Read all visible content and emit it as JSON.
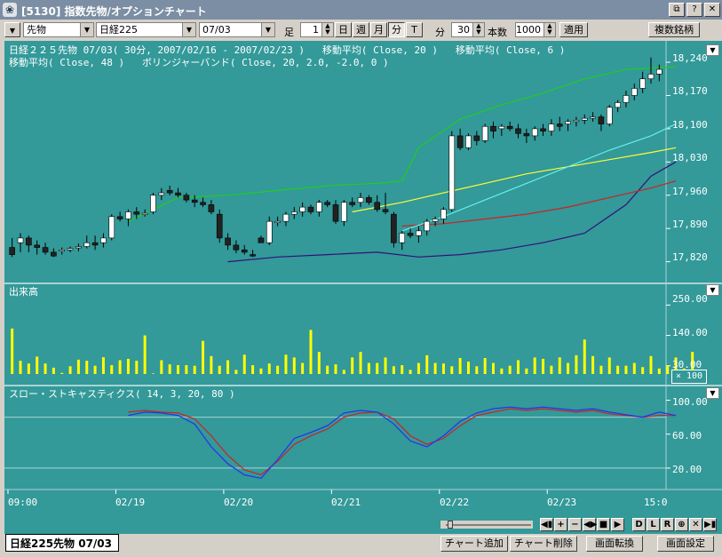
{
  "window": {
    "title": "[5130] 指数先物/オプションチャート",
    "buttons": [
      "⧉",
      "?",
      "✕"
    ]
  },
  "toolbar": {
    "market_select": "先物",
    "index_select": "日経225",
    "month_select": "07/03",
    "ashi_label": "足",
    "ashi_value": "1",
    "period_buttons": [
      "日",
      "週",
      "月",
      "分",
      "T"
    ],
    "pressed_period": "分",
    "minute_label": "分",
    "minute_value": "30",
    "count_label": "本数",
    "count_value": "1000",
    "apply_label": "適用",
    "multi_label": "複数銘柄"
  },
  "price_panel": {
    "header_line1": "日経２２５先物 07/03( 30分, 2007/02/16 - 2007/02/23 )   移動平均( Close, 20 )   移動平均( Close, 6 )",
    "header_line2": "移動平均( Close, 48 )   ボリンジャーバンド( Close, 20, 2.0, -2.0, 0 )",
    "yticks": [
      "18,240",
      "18,170",
      "18,100",
      "18,030",
      "17,960",
      "17,890",
      "17,820"
    ]
  },
  "volume_panel": {
    "title": "出来高",
    "yticks": [
      "250.00",
      "140.00",
      "30.00"
    ],
    "scale": "× 100"
  },
  "stoch_panel": {
    "title": "スロー・ストキャスティクス( 14, 3, 20, 80 )",
    "yticks": [
      "100.00",
      "60.00",
      "20.00"
    ]
  },
  "xaxis": {
    "labels": [
      "09:00",
      "02/19",
      "02/20",
      "02/21",
      "02/22",
      "02/23",
      "15:0"
    ]
  },
  "nav_buttons": [
    "◀▮",
    "+",
    "−",
    "◀▶",
    "■",
    "▶",
    "D",
    "L",
    "R",
    "⊕",
    "✕",
    "▶▮"
  ],
  "bottom": {
    "tab_label": "日経225先物 07/03",
    "buttons": [
      "チャート追加",
      "チャート削除",
      "画面転換",
      "画面設定"
    ]
  },
  "colors": {
    "background": "#339999",
    "ma20": "#cc2222",
    "ma6": "#66eeee",
    "ma48": "#ffff33",
    "bollinger_upper": "#22cc22",
    "bollinger_lower": "#331177",
    "volume": "#ffff00",
    "stoch_k": "#2233ee",
    "stoch_d": "#cc2222"
  },
  "chart_data": [
    {
      "type": "candlestick",
      "title": "日経２２５先物 07/03",
      "ylim": [
        17780,
        18270
      ],
      "y_ticks": [
        18240,
        18170,
        18100,
        18030,
        17960,
        17890,
        17820
      ],
      "candles": [
        [
          17850,
          17870,
          17830,
          17835
        ],
        [
          17860,
          17880,
          17840,
          17870
        ],
        [
          17870,
          17875,
          17840,
          17855
        ],
        [
          17855,
          17865,
          17835,
          17850
        ],
        [
          17850,
          17860,
          17835,
          17840
        ],
        [
          17840,
          17848,
          17830,
          17832
        ],
        [
          17845,
          17850,
          17835,
          17845
        ],
        [
          17845,
          17852,
          17840,
          17848
        ],
        [
          17850,
          17858,
          17842,
          17852
        ],
        [
          17852,
          17875,
          17848,
          17860
        ],
        [
          17860,
          17875,
          17845,
          17855
        ],
        [
          17860,
          17880,
          17850,
          17870
        ],
        [
          17870,
          17920,
          17865,
          17915
        ],
        [
          17915,
          17925,
          17905,
          17910
        ],
        [
          17910,
          17930,
          17895,
          17925
        ],
        [
          17925,
          17935,
          17910,
          17920
        ],
        [
          17920,
          17930,
          17915,
          17922
        ],
        [
          17925,
          17965,
          17920,
          17960
        ],
        [
          17960,
          17975,
          17950,
          17965
        ],
        [
          17970,
          17980,
          17960,
          17965
        ],
        [
          17965,
          17975,
          17955,
          17960
        ],
        [
          17960,
          17965,
          17945,
          17950
        ],
        [
          17950,
          17960,
          17935,
          17945
        ],
        [
          17945,
          17955,
          17935,
          17940
        ],
        [
          17940,
          17950,
          17920,
          17925
        ],
        [
          17920,
          17930,
          17860,
          17870
        ],
        [
          17870,
          17880,
          17845,
          17855
        ],
        [
          17855,
          17865,
          17838,
          17845
        ],
        [
          17845,
          17855,
          17835,
          17840
        ],
        [
          17835,
          17845,
          17830,
          17832
        ],
        [
          17870,
          17875,
          17860,
          17860
        ],
        [
          17860,
          17915,
          17855,
          17905
        ],
        [
          17905,
          17915,
          17895,
          17905
        ],
        [
          17905,
          17925,
          17895,
          17920
        ],
        [
          17920,
          17935,
          17910,
          17925
        ],
        [
          17925,
          17945,
          17915,
          17935
        ],
        [
          17935,
          17940,
          17920,
          17925
        ],
        [
          17925,
          17950,
          17915,
          17945
        ],
        [
          17945,
          17950,
          17935,
          17940
        ],
        [
          17940,
          17950,
          17900,
          17905
        ],
        [
          17905,
          17950,
          17895,
          17945
        ],
        [
          17945,
          17955,
          17935,
          17940
        ],
        [
          17945,
          17965,
          17935,
          17955
        ],
        [
          17955,
          17960,
          17940,
          17945
        ],
        [
          17945,
          17960,
          17925,
          17930
        ],
        [
          17930,
          17965,
          17920,
          17925
        ],
        [
          17920,
          17925,
          17850,
          17860
        ],
        [
          17860,
          17885,
          17845,
          17880
        ],
        [
          17880,
          17890,
          17870,
          17875
        ],
        [
          17875,
          17895,
          17860,
          17885
        ],
        [
          17885,
          17910,
          17875,
          17905
        ],
        [
          17905,
          17915,
          17895,
          17910
        ],
        [
          17910,
          17935,
          17900,
          17930
        ],
        [
          17930,
          18095,
          17925,
          18085
        ],
        [
          18085,
          18100,
          18055,
          18060
        ],
        [
          18060,
          18090,
          18055,
          18085
        ],
        [
          18085,
          18095,
          18065,
          18075
        ],
        [
          18075,
          18110,
          18070,
          18105
        ],
        [
          18105,
          18115,
          18080,
          18095
        ],
        [
          18100,
          18110,
          18085,
          18105
        ],
        [
          18105,
          18115,
          18095,
          18100
        ],
        [
          18100,
          18110,
          18080,
          18090
        ],
        [
          18090,
          18100,
          18070,
          18085
        ],
        [
          18085,
          18105,
          18075,
          18100
        ],
        [
          18100,
          18110,
          18085,
          18095
        ],
        [
          18095,
          18120,
          18085,
          18110
        ],
        [
          18110,
          18125,
          18095,
          18105
        ],
        [
          18110,
          18120,
          18095,
          18115
        ],
        [
          18115,
          18125,
          18105,
          18118
        ],
        [
          18118,
          18130,
          18110,
          18122
        ],
        [
          18122,
          18135,
          18115,
          18125
        ],
        [
          18125,
          18130,
          18095,
          18110
        ],
        [
          18110,
          18150,
          18105,
          18145
        ],
        [
          18145,
          18160,
          18135,
          18155
        ],
        [
          18155,
          18180,
          18145,
          18170
        ],
        [
          18170,
          18195,
          18160,
          18185
        ],
        [
          18185,
          18220,
          18175,
          18205
        ],
        [
          18205,
          18250,
          18195,
          18215
        ],
        [
          18215,
          18235,
          18200,
          18225
        ]
      ],
      "ma20": [
        [
          47,
          17895
        ],
        [
          52,
          17900
        ],
        [
          57,
          17910
        ],
        [
          62,
          17920
        ],
        [
          67,
          17935
        ],
        [
          72,
          17955
        ],
        [
          77,
          17975
        ],
        [
          80,
          17990
        ]
      ],
      "ma6": [
        [
          47,
          17885
        ],
        [
          52,
          17915
        ],
        [
          57,
          17950
        ],
        [
          62,
          17985
        ],
        [
          67,
          18020
        ],
        [
          72,
          18055
        ],
        [
          77,
          18085
        ],
        [
          80,
          18110
        ]
      ],
      "ma48": [
        [
          41,
          17925
        ],
        [
          47,
          17945
        ],
        [
          52,
          17965
        ],
        [
          57,
          17985
        ],
        [
          62,
          18005
        ],
        [
          67,
          18020
        ],
        [
          72,
          18035
        ],
        [
          77,
          18050
        ],
        [
          80,
          18060
        ]
      ],
      "bb_upper": [
        [
          14,
          17905
        ],
        [
          20,
          17955
        ],
        [
          26,
          17960
        ],
        [
          32,
          17970
        ],
        [
          38,
          17980
        ],
        [
          44,
          17985
        ],
        [
          47,
          17990
        ],
        [
          49,
          18060
        ],
        [
          54,
          18120
        ],
        [
          59,
          18150
        ],
        [
          64,
          18175
        ],
        [
          69,
          18205
        ],
        [
          74,
          18225
        ],
        [
          80,
          18230
        ]
      ],
      "bb_lower": [
        [
          26,
          17820
        ],
        [
          32,
          17830
        ],
        [
          38,
          17835
        ],
        [
          44,
          17840
        ],
        [
          49,
          17830
        ],
        [
          54,
          17835
        ],
        [
          59,
          17845
        ],
        [
          64,
          17860
        ],
        [
          69,
          17880
        ],
        [
          74,
          17940
        ],
        [
          77,
          18000
        ],
        [
          80,
          18030
        ]
      ]
    },
    {
      "type": "bar",
      "title": "出来高",
      "ylim": [
        0,
        290
      ],
      "y_ticks": [
        250,
        140,
        30
      ],
      "values": [
        165,
        48,
        38,
        63,
        38,
        23,
        4,
        28,
        52,
        48,
        30,
        61,
        32,
        50,
        55,
        48,
        140,
        2,
        50,
        35,
        32,
        32,
        30,
        120,
        65,
        30,
        50,
        15,
        70,
        32,
        20,
        38,
        30,
        70,
        60,
        40,
        160,
        80,
        30,
        35,
        15,
        60,
        80,
        40,
        40,
        60,
        28,
        32,
        15,
        40,
        68,
        40,
        38,
        28,
        58,
        45,
        28,
        58,
        40,
        20,
        30,
        50,
        20,
        60,
        55,
        30,
        60,
        40,
        68,
        125,
        65,
        30,
        60,
        30,
        30,
        40,
        25,
        65,
        20,
        30,
        60,
        20,
        80
      ],
      "scale": "× 100"
    },
    {
      "type": "line",
      "title": "スロー・ストキャスティクス( 14, 3, 20, 80 )",
      "ylim": [
        0,
        110
      ],
      "y_ticks": [
        100,
        60,
        20
      ],
      "series": [
        {
          "name": "%K",
          "x": [
            14,
            16,
            18,
            20,
            22,
            24,
            26,
            28,
            30,
            32,
            34,
            36,
            38,
            40,
            42,
            44,
            46,
            48,
            50,
            52,
            54,
            56,
            58,
            60,
            62,
            64,
            66,
            68,
            70,
            72,
            74,
            76,
            78,
            80
          ],
          "values": [
            82,
            86,
            85,
            82,
            72,
            45,
            25,
            12,
            8,
            30,
            55,
            62,
            70,
            85,
            88,
            86,
            72,
            52,
            45,
            58,
            75,
            85,
            90,
            92,
            90,
            92,
            90,
            88,
            90,
            86,
            83,
            80,
            86,
            82
          ]
        },
        {
          "name": "%D",
          "x": [
            14,
            16,
            18,
            20,
            22,
            24,
            26,
            28,
            30,
            32,
            34,
            36,
            38,
            40,
            42,
            44,
            46,
            48,
            50,
            52,
            54,
            56,
            58,
            60,
            62,
            64,
            66,
            68,
            70,
            72,
            74,
            76,
            78,
            80
          ],
          "values": [
            86,
            88,
            86,
            85,
            78,
            58,
            35,
            18,
            12,
            28,
            48,
            58,
            66,
            80,
            85,
            86,
            78,
            58,
            48,
            55,
            70,
            82,
            86,
            90,
            88,
            90,
            88,
            86,
            88,
            84,
            82,
            80,
            82,
            82
          ]
        }
      ]
    }
  ]
}
